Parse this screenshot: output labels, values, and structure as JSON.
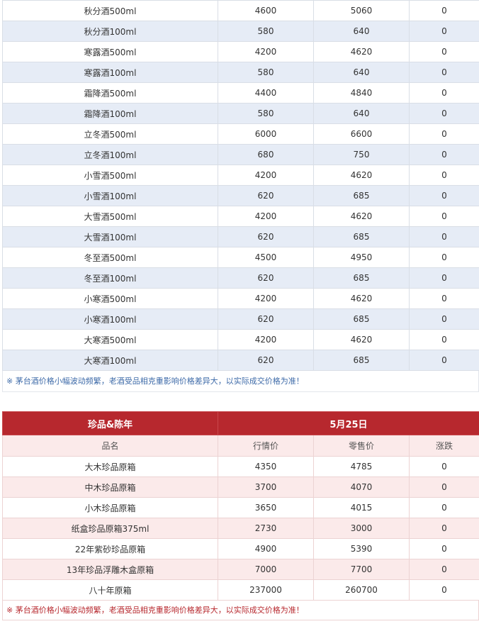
{
  "solar_terms_table": {
    "rows": [
      {
        "name": "秋分酒500ml",
        "market": "4600",
        "retail": "5060",
        "change": "0"
      },
      {
        "name": "秋分酒100ml",
        "market": "580",
        "retail": "640",
        "change": "0"
      },
      {
        "name": "寒露酒500ml",
        "market": "4200",
        "retail": "4620",
        "change": "0"
      },
      {
        "name": "寒露酒100ml",
        "market": "580",
        "retail": "640",
        "change": "0"
      },
      {
        "name": "霜降酒500ml",
        "market": "4400",
        "retail": "4840",
        "change": "0"
      },
      {
        "name": "霜降酒100ml",
        "market": "580",
        "retail": "640",
        "change": "0"
      },
      {
        "name": "立冬酒500ml",
        "market": "6000",
        "retail": "6600",
        "change": "0"
      },
      {
        "name": "立冬酒100ml",
        "market": "680",
        "retail": "750",
        "change": "0"
      },
      {
        "name": "小雪酒500ml",
        "market": "4200",
        "retail": "4620",
        "change": "0"
      },
      {
        "name": "小雪酒100ml",
        "market": "620",
        "retail": "685",
        "change": "0"
      },
      {
        "name": "大雪酒500ml",
        "market": "4200",
        "retail": "4620",
        "change": "0"
      },
      {
        "name": "大雪酒100ml",
        "market": "620",
        "retail": "685",
        "change": "0"
      },
      {
        "name": "冬至酒500ml",
        "market": "4500",
        "retail": "4950",
        "change": "0"
      },
      {
        "name": "冬至酒100ml",
        "market": "620",
        "retail": "685",
        "change": "0"
      },
      {
        "name": "小寒酒500ml",
        "market": "4200",
        "retail": "4620",
        "change": "0"
      },
      {
        "name": "小寒酒100ml",
        "market": "620",
        "retail": "685",
        "change": "0"
      },
      {
        "name": "大寒酒500ml",
        "market": "4200",
        "retail": "4620",
        "change": "0"
      },
      {
        "name": "大寒酒100ml",
        "market": "620",
        "retail": "685",
        "change": "0"
      }
    ],
    "note": "※ 茅台酒价格小幅波动频繁，老酒受品相克重影响价格差异大，以实际成交价格为准！",
    "row_stripe_color": "#e6ecf6",
    "note_color": "#3d6aa8"
  },
  "rare_vintage_table": {
    "category": "珍品&陈年",
    "date": "5月25日",
    "columns": {
      "name": "品名",
      "market": "行情价",
      "retail": "零售价",
      "change": "涨跌"
    },
    "rows": [
      {
        "name": "大木珍品原箱",
        "market": "4350",
        "retail": "4785",
        "change": "0"
      },
      {
        "name": "中木珍品原箱",
        "market": "3700",
        "retail": "4070",
        "change": "0"
      },
      {
        "name": "小木珍品原箱",
        "market": "3650",
        "retail": "4015",
        "change": "0"
      },
      {
        "name": "纸盒珍品原箱375ml",
        "market": "2730",
        "retail": "3000",
        "change": "0"
      },
      {
        "name": "22年紫砂珍品原箱",
        "market": "4900",
        "retail": "5390",
        "change": "0"
      },
      {
        "name": "13年珍品浮雕木盒原箱",
        "market": "7000",
        "retail": "7700",
        "change": "0"
      },
      {
        "name": "八十年原箱",
        "market": "237000",
        "retail": "260700",
        "change": "0"
      }
    ],
    "note": "※ 茅台酒价格小幅波动频繁，老酒受品相克重影响价格差异大，以实际成交价格为准！",
    "header_color": "#b7282e",
    "row_stripe_color": "#fbeaea"
  }
}
